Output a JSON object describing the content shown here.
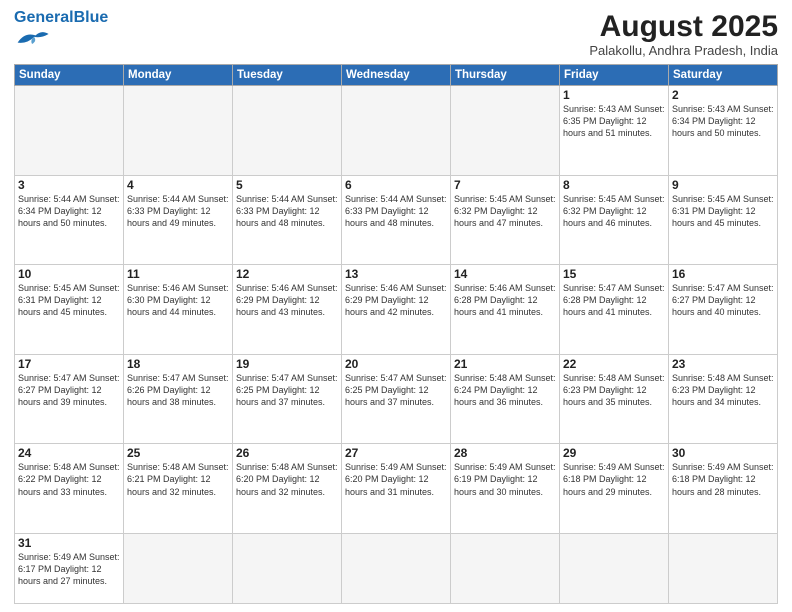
{
  "header": {
    "logo_general": "General",
    "logo_blue": "Blue",
    "main_title": "August 2025",
    "subtitle": "Palakollu, Andhra Pradesh, India"
  },
  "days_of_week": [
    "Sunday",
    "Monday",
    "Tuesday",
    "Wednesday",
    "Thursday",
    "Friday",
    "Saturday"
  ],
  "weeks": [
    [
      {
        "day": "",
        "info": ""
      },
      {
        "day": "",
        "info": ""
      },
      {
        "day": "",
        "info": ""
      },
      {
        "day": "",
        "info": ""
      },
      {
        "day": "",
        "info": ""
      },
      {
        "day": "1",
        "info": "Sunrise: 5:43 AM\nSunset: 6:35 PM\nDaylight: 12 hours\nand 51 minutes."
      },
      {
        "day": "2",
        "info": "Sunrise: 5:43 AM\nSunset: 6:34 PM\nDaylight: 12 hours\nand 50 minutes."
      }
    ],
    [
      {
        "day": "3",
        "info": "Sunrise: 5:44 AM\nSunset: 6:34 PM\nDaylight: 12 hours\nand 50 minutes."
      },
      {
        "day": "4",
        "info": "Sunrise: 5:44 AM\nSunset: 6:33 PM\nDaylight: 12 hours\nand 49 minutes."
      },
      {
        "day": "5",
        "info": "Sunrise: 5:44 AM\nSunset: 6:33 PM\nDaylight: 12 hours\nand 48 minutes."
      },
      {
        "day": "6",
        "info": "Sunrise: 5:44 AM\nSunset: 6:33 PM\nDaylight: 12 hours\nand 48 minutes."
      },
      {
        "day": "7",
        "info": "Sunrise: 5:45 AM\nSunset: 6:32 PM\nDaylight: 12 hours\nand 47 minutes."
      },
      {
        "day": "8",
        "info": "Sunrise: 5:45 AM\nSunset: 6:32 PM\nDaylight: 12 hours\nand 46 minutes."
      },
      {
        "day": "9",
        "info": "Sunrise: 5:45 AM\nSunset: 6:31 PM\nDaylight: 12 hours\nand 45 minutes."
      }
    ],
    [
      {
        "day": "10",
        "info": "Sunrise: 5:45 AM\nSunset: 6:31 PM\nDaylight: 12 hours\nand 45 minutes."
      },
      {
        "day": "11",
        "info": "Sunrise: 5:46 AM\nSunset: 6:30 PM\nDaylight: 12 hours\nand 44 minutes."
      },
      {
        "day": "12",
        "info": "Sunrise: 5:46 AM\nSunset: 6:29 PM\nDaylight: 12 hours\nand 43 minutes."
      },
      {
        "day": "13",
        "info": "Sunrise: 5:46 AM\nSunset: 6:29 PM\nDaylight: 12 hours\nand 42 minutes."
      },
      {
        "day": "14",
        "info": "Sunrise: 5:46 AM\nSunset: 6:28 PM\nDaylight: 12 hours\nand 41 minutes."
      },
      {
        "day": "15",
        "info": "Sunrise: 5:47 AM\nSunset: 6:28 PM\nDaylight: 12 hours\nand 41 minutes."
      },
      {
        "day": "16",
        "info": "Sunrise: 5:47 AM\nSunset: 6:27 PM\nDaylight: 12 hours\nand 40 minutes."
      }
    ],
    [
      {
        "day": "17",
        "info": "Sunrise: 5:47 AM\nSunset: 6:27 PM\nDaylight: 12 hours\nand 39 minutes."
      },
      {
        "day": "18",
        "info": "Sunrise: 5:47 AM\nSunset: 6:26 PM\nDaylight: 12 hours\nand 38 minutes."
      },
      {
        "day": "19",
        "info": "Sunrise: 5:47 AM\nSunset: 6:25 PM\nDaylight: 12 hours\nand 37 minutes."
      },
      {
        "day": "20",
        "info": "Sunrise: 5:47 AM\nSunset: 6:25 PM\nDaylight: 12 hours\nand 37 minutes."
      },
      {
        "day": "21",
        "info": "Sunrise: 5:48 AM\nSunset: 6:24 PM\nDaylight: 12 hours\nand 36 minutes."
      },
      {
        "day": "22",
        "info": "Sunrise: 5:48 AM\nSunset: 6:23 PM\nDaylight: 12 hours\nand 35 minutes."
      },
      {
        "day": "23",
        "info": "Sunrise: 5:48 AM\nSunset: 6:23 PM\nDaylight: 12 hours\nand 34 minutes."
      }
    ],
    [
      {
        "day": "24",
        "info": "Sunrise: 5:48 AM\nSunset: 6:22 PM\nDaylight: 12 hours\nand 33 minutes."
      },
      {
        "day": "25",
        "info": "Sunrise: 5:48 AM\nSunset: 6:21 PM\nDaylight: 12 hours\nand 32 minutes."
      },
      {
        "day": "26",
        "info": "Sunrise: 5:48 AM\nSunset: 6:20 PM\nDaylight: 12 hours\nand 32 minutes."
      },
      {
        "day": "27",
        "info": "Sunrise: 5:49 AM\nSunset: 6:20 PM\nDaylight: 12 hours\nand 31 minutes."
      },
      {
        "day": "28",
        "info": "Sunrise: 5:49 AM\nSunset: 6:19 PM\nDaylight: 12 hours\nand 30 minutes."
      },
      {
        "day": "29",
        "info": "Sunrise: 5:49 AM\nSunset: 6:18 PM\nDaylight: 12 hours\nand 29 minutes."
      },
      {
        "day": "30",
        "info": "Sunrise: 5:49 AM\nSunset: 6:18 PM\nDaylight: 12 hours\nand 28 minutes."
      }
    ],
    [
      {
        "day": "31",
        "info": "Sunrise: 5:49 AM\nSunset: 6:17 PM\nDaylight: 12 hours\nand 27 minutes."
      },
      {
        "day": "",
        "info": ""
      },
      {
        "day": "",
        "info": ""
      },
      {
        "day": "",
        "info": ""
      },
      {
        "day": "",
        "info": ""
      },
      {
        "day": "",
        "info": ""
      },
      {
        "day": "",
        "info": ""
      }
    ]
  ]
}
